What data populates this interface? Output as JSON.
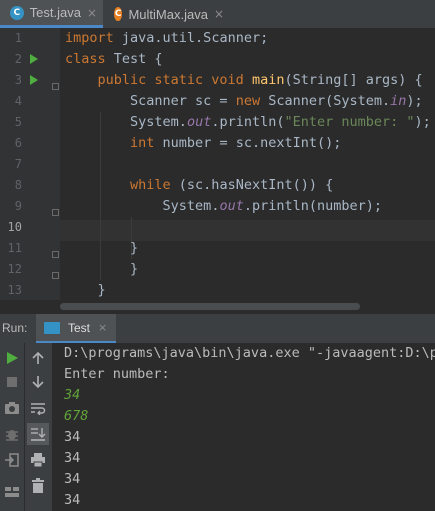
{
  "tabs": [
    {
      "label": "Test.java",
      "icon": "java-class-icon",
      "active": true
    },
    {
      "label": "MultiMax.java",
      "icon": "java-class-icon",
      "active": false
    }
  ],
  "tab_close_glyph": "×",
  "editor": {
    "line_numbers": [
      "1",
      "2",
      "3",
      "4",
      "5",
      "6",
      "7",
      "8",
      "9",
      "10",
      "11",
      "12",
      "13"
    ],
    "current_line": "10"
  },
  "code": {
    "l1_kw": "import",
    "l1_rest": " java.util.Scanner;",
    "l2_kw": "class",
    "l2_rest": " Test {",
    "l3_kw": "public static void",
    "l3_fn": "main",
    "l3_rest": "(String[] args) {",
    "l4_a": "Scanner sc = ",
    "l4_kw": "new",
    "l4_b": " Scanner(System.",
    "l4_fld": "in",
    "l4_c": ");",
    "l5_a": "System.",
    "l5_fld": "out",
    "l5_b": ".println(",
    "l5_str": "\"Enter number: \"",
    "l5_c": ");",
    "l6_kw": "int",
    "l6_rest": " number = sc.nextInt();",
    "l8_kw": "while",
    "l8_rest": " (sc.hasNextInt()) {",
    "l9_a": "System.",
    "l9_fld": "out",
    "l9_b": ".println(number);",
    "l11": "}",
    "l12": "}",
    "l13": "}"
  },
  "run_panel": {
    "label": "Run:",
    "tab_label": "Test",
    "close_glyph": "×"
  },
  "console": {
    "command": "D:\\programs\\java\\bin\\java.exe \"-javaagent:D:\\pr",
    "prompt": "Enter number:",
    "inputs": [
      "34",
      "678"
    ],
    "outputs": [
      "34",
      "34",
      "34",
      "34"
    ]
  },
  "colors": {
    "keyword": "#cc7832",
    "function": "#ffc66d",
    "string": "#6a8759",
    "field": "#9876aa",
    "user_input": "#62a33a",
    "accent": "#4a88c7"
  }
}
